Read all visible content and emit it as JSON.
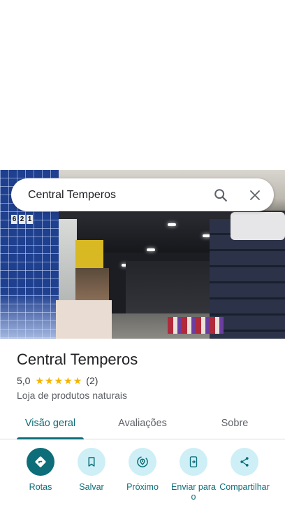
{
  "search": {
    "query": "Central Temperos"
  },
  "hero": {
    "building_number": [
      "6",
      "2",
      "1"
    ]
  },
  "place": {
    "title": "Central Temperos",
    "rating_value": "5,0",
    "rating_stars": 5,
    "review_count": "(2)",
    "category": "Loja de produtos naturais"
  },
  "tabs": [
    {
      "label": "Visão geral",
      "active": true
    },
    {
      "label": "Avaliações",
      "active": false
    },
    {
      "label": "Sobre",
      "active": false
    }
  ],
  "actions": [
    {
      "label": "Rotas",
      "icon": "directions-icon"
    },
    {
      "label": "Salvar",
      "icon": "bookmark-icon"
    },
    {
      "label": "Próximo",
      "icon": "nearby-icon"
    },
    {
      "label": "Enviar para o",
      "icon": "send-to-phone-icon"
    },
    {
      "label": "Compartilhar",
      "icon": "share-icon"
    }
  ],
  "colors": {
    "accent": "#0d6e79",
    "action_bg": "#cdeff5",
    "star": "#f4b400"
  }
}
